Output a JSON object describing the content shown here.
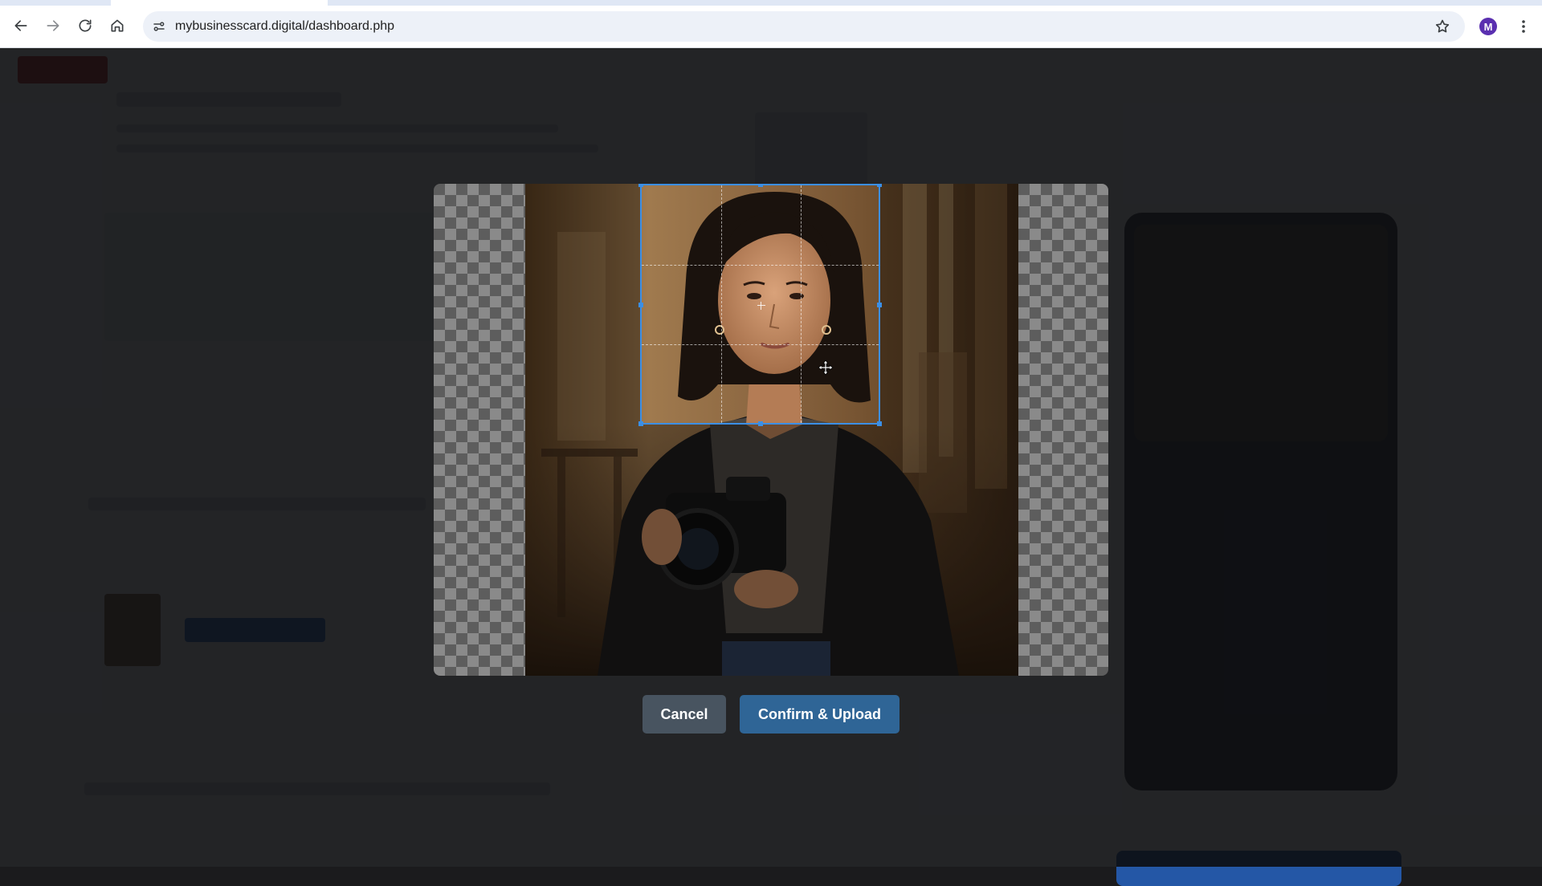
{
  "browser": {
    "url": "mybusinesscard.digital/dashboard.php",
    "profile_initial": "M"
  },
  "cropper": {
    "cancel_label": "Cancel",
    "confirm_label": "Confirm & Upload"
  }
}
